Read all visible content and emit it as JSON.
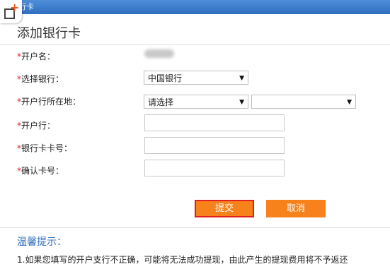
{
  "window": {
    "title": "行卡"
  },
  "form": {
    "heading": "添加银行卡",
    "required_mark": "*",
    "fields": {
      "account_name": {
        "label": "开户名："
      },
      "bank": {
        "label": "选择银行：",
        "selected": "中国银行"
      },
      "location": {
        "label": "开户行所在地：",
        "province_selected": "请选择",
        "city_selected": ""
      },
      "branch": {
        "label": "开户行：",
        "value": ""
      },
      "card_number": {
        "label": "银行卡卡号：",
        "value": ""
      },
      "confirm_card": {
        "label": "确认卡号：",
        "value": ""
      }
    },
    "submit_label": "提交",
    "cancel_label": "取消"
  },
  "tips": {
    "title": "温馨提示：",
    "line1": "1.如果您填写的开户支行不正确，可能将无法成功提现，由此产生的提现费用将不予返还"
  },
  "icons": {
    "corner": "add-window-icon",
    "dropdown": "dropdown-caret-icon"
  },
  "colors": {
    "titlebar": "#2f6fbf",
    "button": "#f7821b",
    "button_highlight_border": "#e02020",
    "required": "#e02020",
    "tips_title": "#2f6fbf"
  }
}
